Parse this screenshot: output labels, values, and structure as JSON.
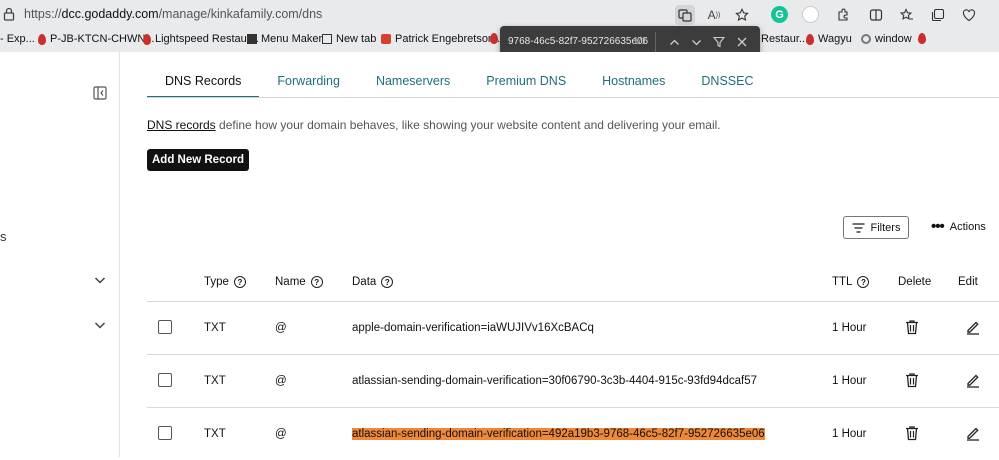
{
  "browser": {
    "url_scheme": "https://",
    "url_host": "dcc.godaddy.com",
    "url_path": "/manage/kinkafamily.com/dns",
    "bookmarks": [
      {
        "label": "- Exp..."
      },
      {
        "label": "P-JB-KTCN-CHWN..."
      },
      {
        "label": "Lightspeed Restaur..."
      },
      {
        "label": "Menu Maker"
      },
      {
        "label": "New tab"
      },
      {
        "label": "Patrick Engebretson..."
      },
      {
        "label": "Restaur..."
      },
      {
        "label": "Wagyu"
      },
      {
        "label": "window"
      }
    ],
    "find": {
      "query": "9768-46c5-82f7-952726635e06",
      "count": "1/1"
    }
  },
  "sidebar": {
    "fragment": "s"
  },
  "tabs": [
    {
      "label": "DNS Records"
    },
    {
      "label": "Forwarding"
    },
    {
      "label": "Nameservers"
    },
    {
      "label": "Premium DNS"
    },
    {
      "label": "Hostnames"
    },
    {
      "label": "DNSSEC"
    }
  ],
  "description": {
    "link": "DNS records",
    "text": " define how your domain behaves, like showing your website content and delivering your email."
  },
  "add_button": "Add New Record",
  "filters_button": "Filters",
  "actions_label": "Actions",
  "table": {
    "headers": {
      "type": "Type",
      "name": "Name",
      "data": "Data",
      "ttl": "TTL",
      "delete": "Delete",
      "edit": "Edit"
    },
    "rows": [
      {
        "type": "TXT",
        "name": "@",
        "data": "apple-domain-verification=iaWUJIVv16XcBACq",
        "ttl": "1 Hour",
        "highlighted": false
      },
      {
        "type": "TXT",
        "name": "@",
        "data": "atlassian-sending-domain-verification=30f06790-3c3b-4404-915c-93fd94dcaf57",
        "ttl": "1 Hour",
        "highlighted": false
      },
      {
        "type": "TXT",
        "name": "@",
        "data": "atlassian-sending-domain-verification=492a19b3-9768-46c5-82f7-952726635e06",
        "ttl": "1 Hour",
        "highlighted": true
      }
    ]
  },
  "colors": {
    "accent": "#1f6f78",
    "find_highlight": "#f0883a",
    "button_dark": "#111111"
  }
}
